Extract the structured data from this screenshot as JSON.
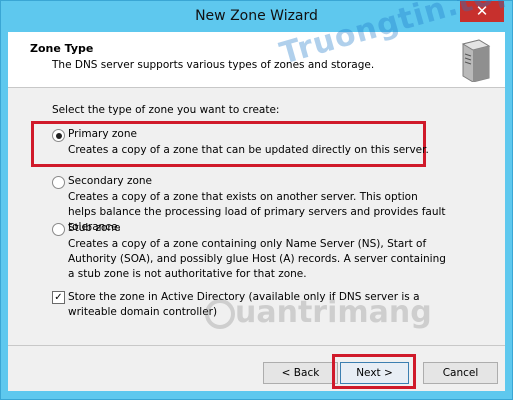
{
  "window": {
    "title": "New Zone Wizard",
    "close_glyph": "✕"
  },
  "header": {
    "title": "Zone Type",
    "subtitle": "The DNS server supports various types of zones and storage."
  },
  "prompt": "Select the type of zone you want to create:",
  "options": [
    {
      "label": "Primary zone",
      "selected": true,
      "description": "Creates a copy of a zone that can be updated directly on this server."
    },
    {
      "label": "Secondary zone",
      "selected": false,
      "description": "Creates a copy of a zone that exists on another server. This option helps balance the processing load of primary servers and provides fault tolerance."
    },
    {
      "label": "Stub zone",
      "selected": false,
      "description": "Creates a copy of a zone containing only Name Server (NS), Start of Authority (SOA), and possibly glue Host (A) records. A server containing a stub zone is not authoritative for that zone."
    }
  ],
  "store_ad": {
    "checked": true,
    "check_glyph": "✓",
    "label": "Store the zone in Active Directory (available only if DNS server is a writeable domain controller)"
  },
  "buttons": {
    "back": "< Back",
    "next": "Next >",
    "cancel": "Cancel"
  },
  "watermarks": {
    "top": "Truongtin.top",
    "bottom": "uantrimang"
  },
  "colors": {
    "highlight": "#d01a2a",
    "titlebar": "#5ec8ee",
    "close": "#c7302d"
  }
}
